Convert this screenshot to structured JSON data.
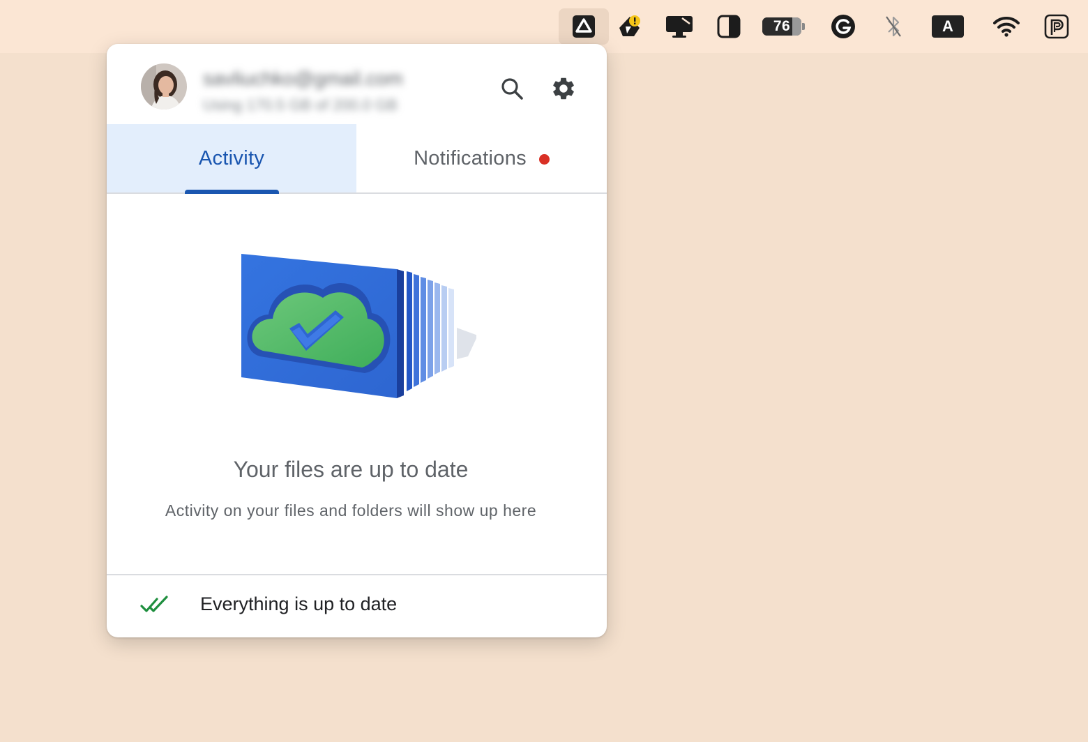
{
  "menubar": {
    "battery_percent": "76",
    "input_source": "A"
  },
  "account": {
    "email": "savliuchko@gmail.com",
    "storage": "Using 170.5 GB of 200.0 GB"
  },
  "tabs": [
    {
      "label": "Activity",
      "active": true
    },
    {
      "label": "Notifications",
      "active": false,
      "has_badge": true
    }
  ],
  "empty_state": {
    "title": "Your files are up to date",
    "subtitle": "Activity on your files and folders will show up here"
  },
  "footer": {
    "status": "Everything is up to date"
  },
  "colors": {
    "accent": "#1a56b0",
    "badge": "#d93025",
    "success": "#1e8e3e"
  }
}
